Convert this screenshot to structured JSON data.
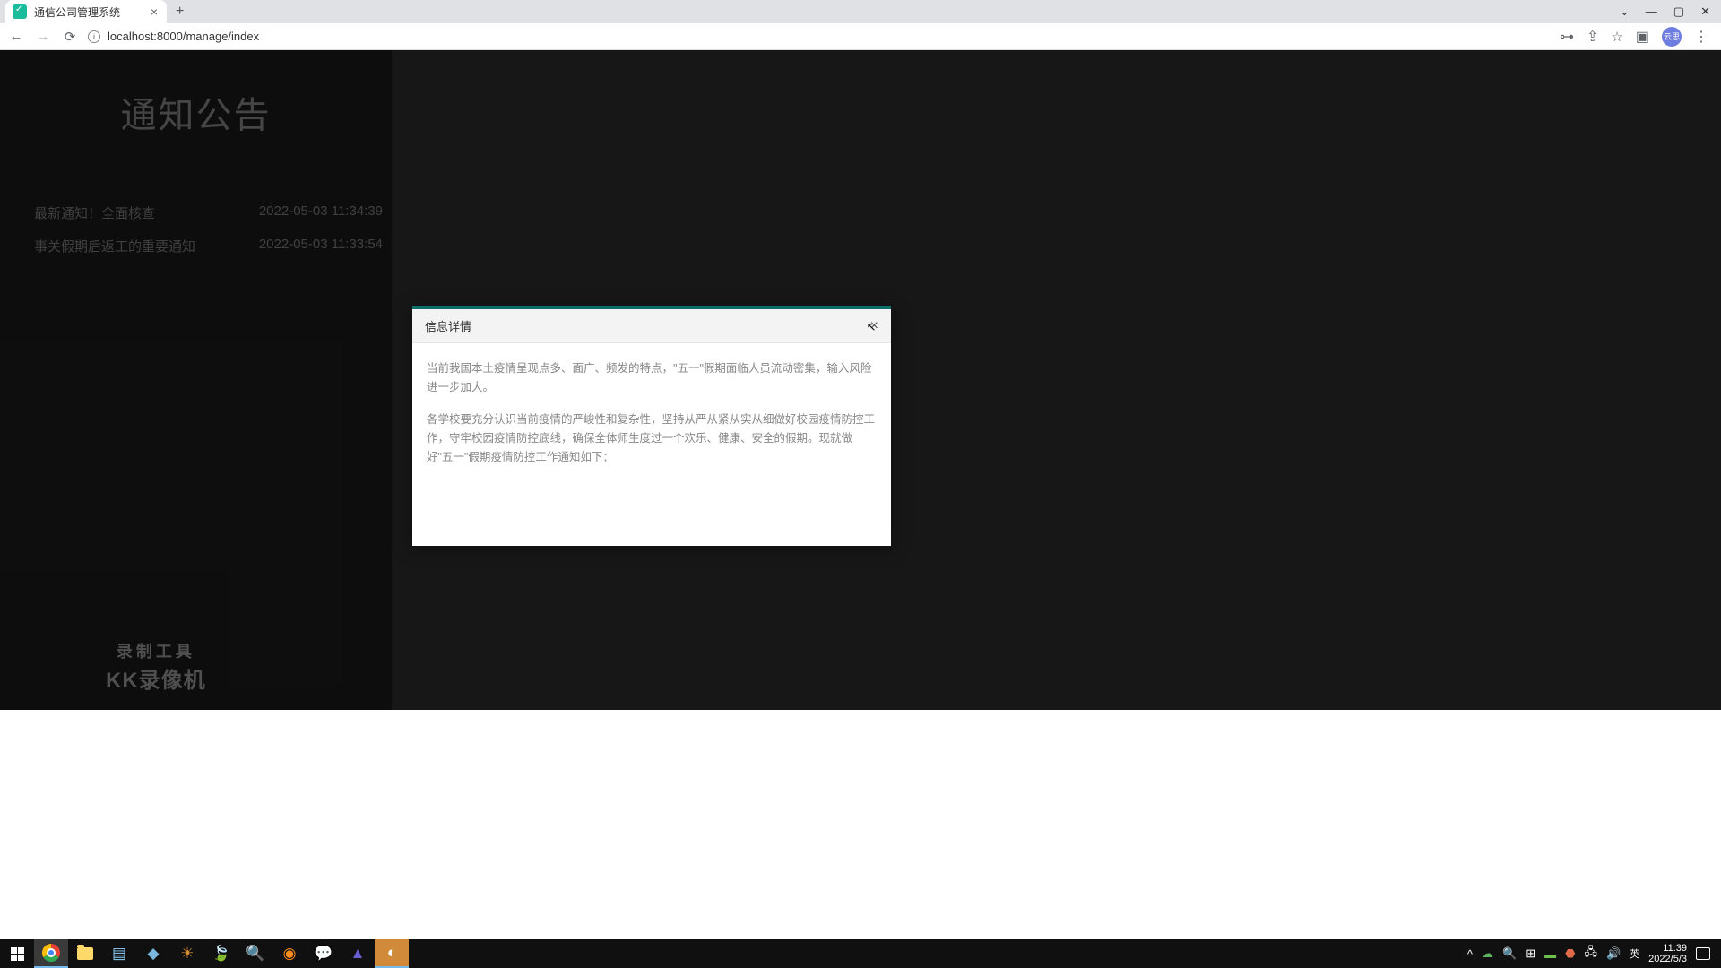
{
  "browser": {
    "tab_title": "通信公司管理系统",
    "url": "localhost:8000/manage/index",
    "profile_label": "云思"
  },
  "sidebar": {
    "title": "通知公告",
    "notices": [
      {
        "title": "最新通知！全面核查",
        "time": "2022-05-03 11:34:39"
      },
      {
        "title": "事关假期后返工的重要通知",
        "time": "2022-05-03 11:33:54"
      }
    ],
    "watermark_line1": "录制工具",
    "watermark_line2": "KK录像机"
  },
  "modal": {
    "title": "信息详情",
    "para1": "当前我国本土疫情呈现点多、面广、频发的特点，\"五一\"假期面临人员流动密集，输入风险进一步加大。",
    "para2": "各学校要充分认识当前疫情的严峻性和复杂性，坚持从严从紧从实从细做好校园疫情防控工作，守牢校园疫情防控底线，确保全体师生度过一个欢乐、健康、安全的假期。现就做好\"五一\"假期疫情防控工作通知如下："
  },
  "taskbar": {
    "ime": "英",
    "time": "11:39",
    "date": "2022/5/3"
  }
}
